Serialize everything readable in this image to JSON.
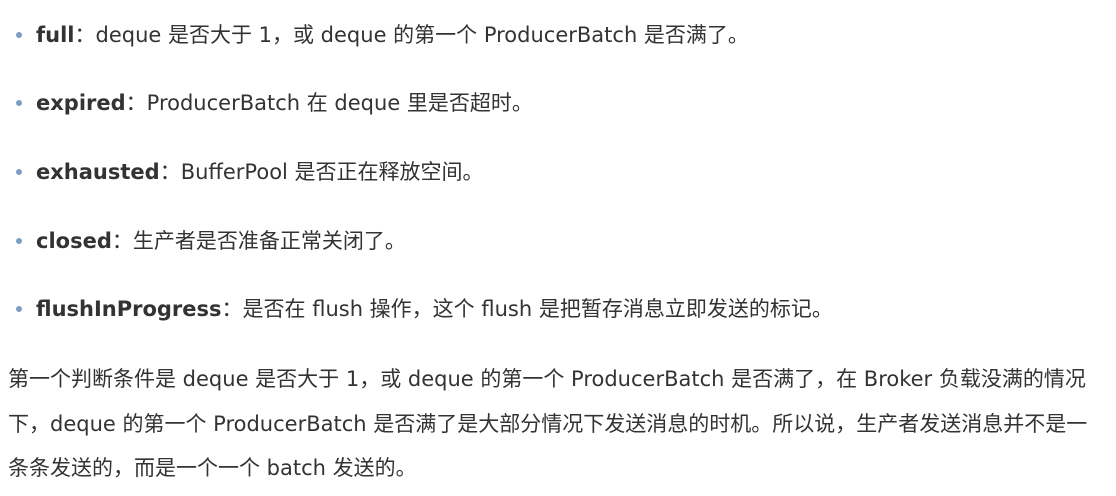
{
  "list": {
    "items": [
      {
        "term": "full",
        "sep": "：",
        "desc": "deque 是否大于 1，或 deque 的第一个 ProducerBatch 是否满了。"
      },
      {
        "term": "expired",
        "sep": "：",
        "desc": "ProducerBatch 在 deque 里是否超时。"
      },
      {
        "term": "exhausted",
        "sep": "：",
        "desc": "BufferPool 是否正在释放空间。"
      },
      {
        "term": "closed",
        "sep": "：",
        "desc": "生产者是否准备正常关闭了。"
      },
      {
        "term": "flushInProgress",
        "sep": "：",
        "desc": "是否在 flush 操作，这个 flush 是把暂存消息立即发送的标记。"
      }
    ]
  },
  "paragraph": {
    "text": "第一个判断条件是 deque 是否大于 1，或 deque 的第一个 ProducerBatch 是否满了，在 Broker 负载没满的情况下，deque 的第一个 ProducerBatch 是否满了是大部分情况下发送消息的时机。所以说，生产者发送消息并不是一条条发送的，而是一个一个 batch 发送的。"
  },
  "colors": {
    "text": "#333333",
    "bullet": "#7e9cc4",
    "background": "#ffffff"
  }
}
